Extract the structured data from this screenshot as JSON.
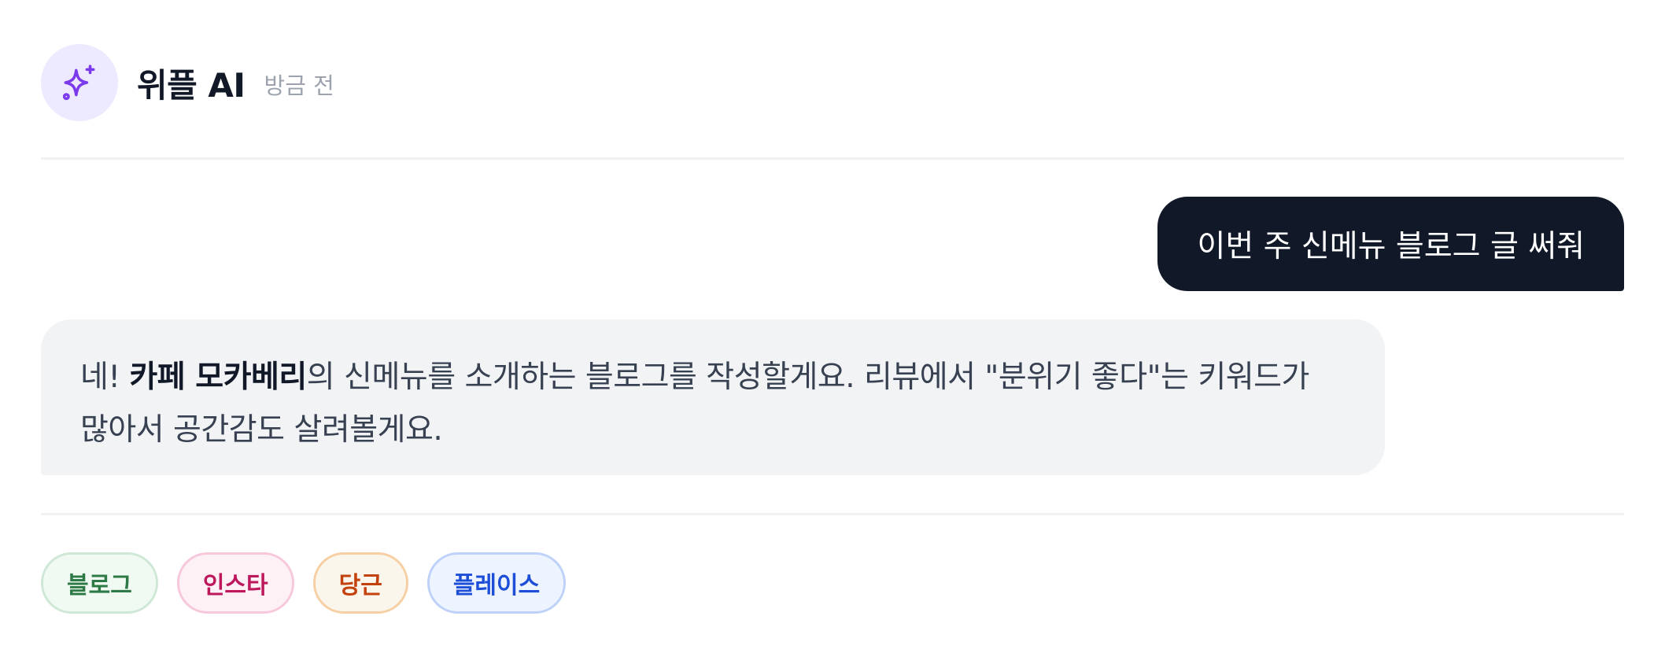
{
  "header": {
    "sender_name": "위플 AI",
    "timestamp": "방금 전",
    "avatar_icon": "sparkles-icon",
    "avatar_color": "#7c3aed",
    "avatar_bg": "#ede9fe"
  },
  "user_message": {
    "text": "이번 주 신메뉴 블로그 글 써줘"
  },
  "ai_message": {
    "greeting": "네! ",
    "cafe_name": "카페 모카베리",
    "line1_rest": "의 신메뉴를 소개하는 블로그를 작성할게요. 리뷰에서 \"분위기 좋다\"는 키워드가",
    "line2": "많아서 공간감도 살려볼게요."
  },
  "chips": [
    {
      "label": "블로그",
      "color": "#2e7a46"
    },
    {
      "label": "인스타",
      "color": "#be185d"
    },
    {
      "label": "당근",
      "color": "#c2410c"
    },
    {
      "label": "플레이스",
      "color": "#1d4ed8"
    }
  ]
}
